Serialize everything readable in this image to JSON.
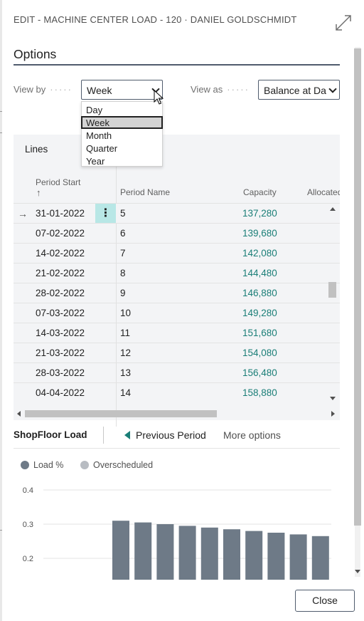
{
  "dialog": {
    "title": "EDIT - MACHINE CENTER LOAD - 120 · DANIEL GOLDSCHMIDT",
    "close_label": "Close"
  },
  "options": {
    "heading": "Options",
    "view_by": {
      "label": "View by",
      "value": "Week"
    },
    "view_as": {
      "label": "View as",
      "value": "Balance at Da"
    },
    "view_by_dropdown": {
      "items": [
        "Day",
        "Week",
        "Month",
        "Quarter",
        "Year"
      ],
      "selected": "Week"
    }
  },
  "lines": {
    "heading": "Lines",
    "columns": {
      "period_start": "Period Start",
      "sort_indicator": "↑",
      "period_name": "Period Name",
      "capacity": "Capacity",
      "allocated": "Allocated"
    },
    "rows": [
      {
        "start": "31-01-2022",
        "name": "5",
        "capacity": "137,280"
      },
      {
        "start": "07-02-2022",
        "name": "6",
        "capacity": "139,680"
      },
      {
        "start": "14-02-2022",
        "name": "7",
        "capacity": "142,080"
      },
      {
        "start": "21-02-2022",
        "name": "8",
        "capacity": "144,480"
      },
      {
        "start": "28-02-2022",
        "name": "9",
        "capacity": "146,880"
      },
      {
        "start": "07-03-2022",
        "name": "10",
        "capacity": "149,280"
      },
      {
        "start": "14-03-2022",
        "name": "11",
        "capacity": "151,680"
      },
      {
        "start": "21-03-2022",
        "name": "12",
        "capacity": "154,080"
      },
      {
        "start": "28-03-2022",
        "name": "13",
        "capacity": "156,480"
      },
      {
        "start": "04-04-2022",
        "name": "14",
        "capacity": "158,880"
      }
    ],
    "current_row_marker": "→",
    "row_menu_glyph": "⋮"
  },
  "shopfloor": {
    "title": "ShopFloor Load",
    "previous_period": "Previous Period",
    "more_options": "More options"
  },
  "colors": {
    "accent": "#1a7e77",
    "bar": "#6e7a87",
    "legend_overscheduled": "#b8bcc2",
    "selected_row_menu": "#b8e7e6"
  },
  "chart_data": {
    "type": "bar",
    "legend": [
      "Load %",
      "Overscheduled"
    ],
    "legend_position": "top-left",
    "ylim": [
      0.14,
      0.42
    ],
    "yticks": [
      0.4,
      0.3,
      0.2
    ],
    "grid": true,
    "series": [
      {
        "name": "Load %",
        "values": [
          0.31,
          0.305,
          0.3,
          0.295,
          0.29,
          0.285,
          0.28,
          0.275,
          0.27,
          0.265
        ]
      }
    ]
  }
}
